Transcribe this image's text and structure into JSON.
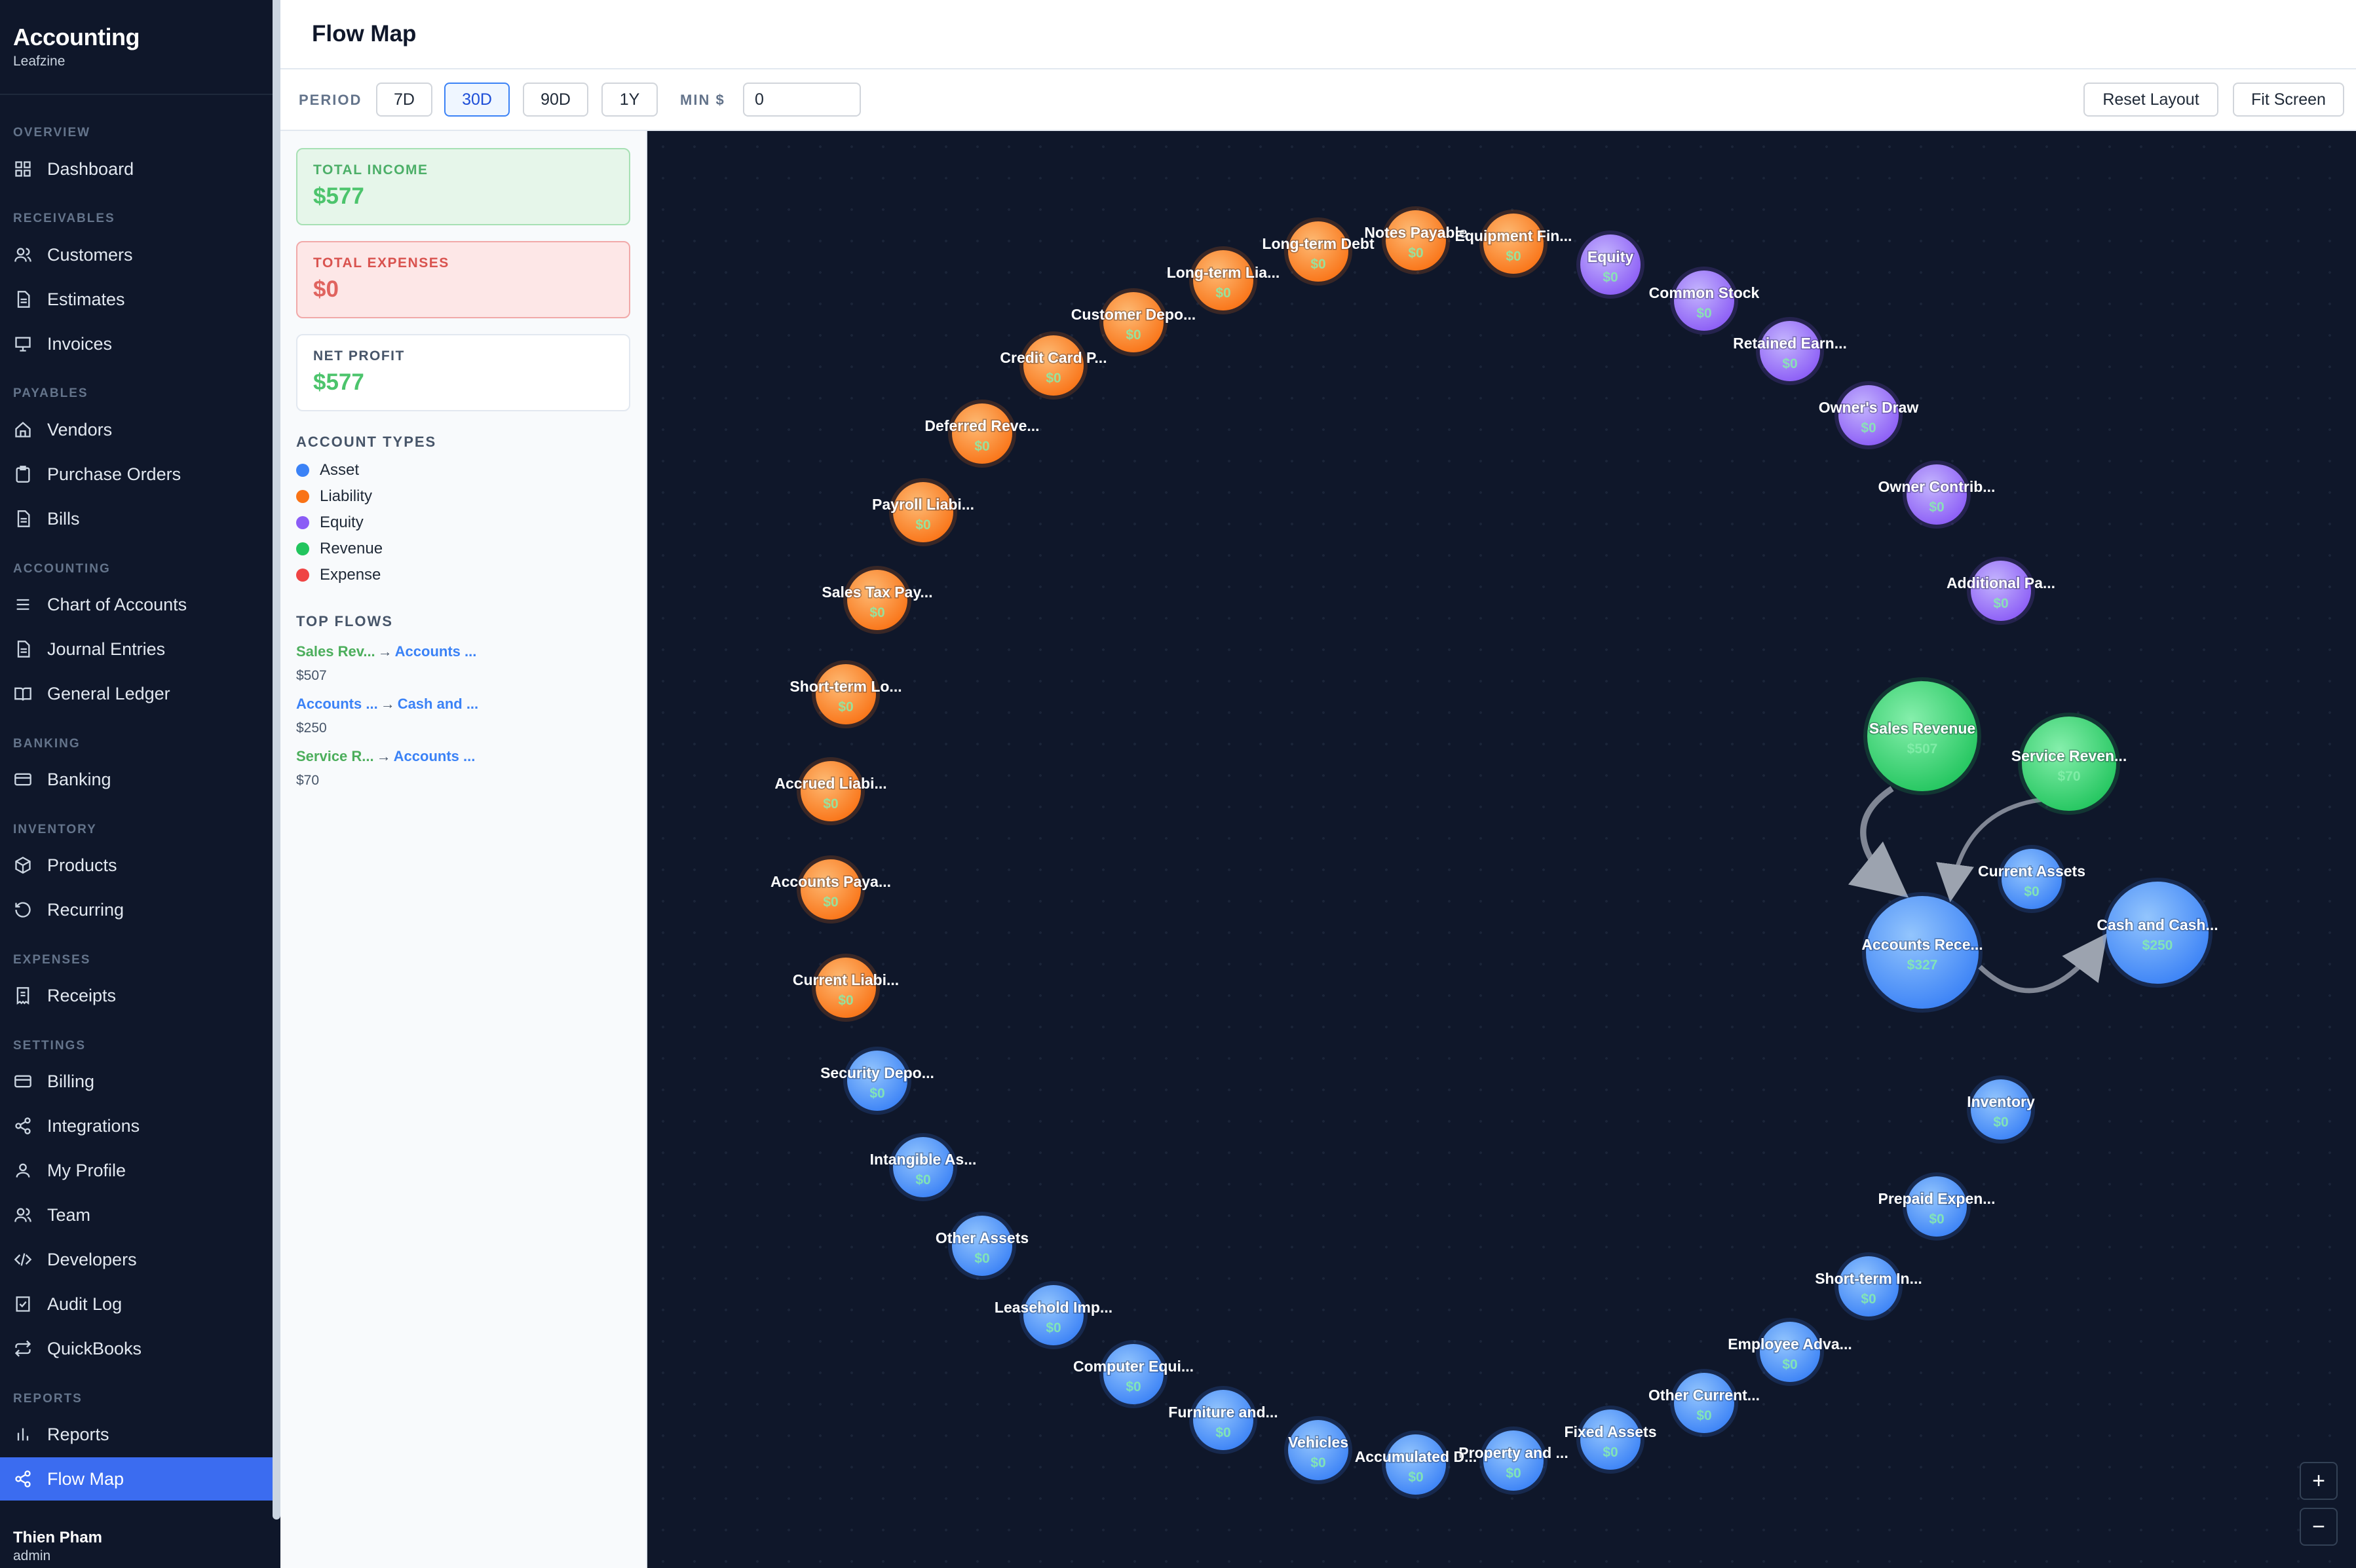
{
  "sidebar": {
    "app_name": "Accounting",
    "org": "Leafzine",
    "sections": {
      "overview": "OVERVIEW",
      "receivables": "RECEIVABLES",
      "payables": "PAYABLES",
      "accounting": "ACCOUNTING",
      "banking": "BANKING",
      "inventory": "INVENTORY",
      "expenses": "EXPENSES",
      "settings": "SETTINGS",
      "reports": "REPORTS"
    },
    "items": {
      "dashboard": "Dashboard",
      "customers": "Customers",
      "estimates": "Estimates",
      "invoices": "Invoices",
      "vendors": "Vendors",
      "purchase_orders": "Purchase Orders",
      "bills": "Bills",
      "chart_of_accounts": "Chart of Accounts",
      "journal_entries": "Journal Entries",
      "general_ledger": "General Ledger",
      "banking": "Banking",
      "products": "Products",
      "recurring": "Recurring",
      "receipts": "Receipts",
      "billing": "Billing",
      "integrations": "Integrations",
      "my_profile": "My Profile",
      "team": "Team",
      "developers": "Developers",
      "audit_log": "Audit Log",
      "quickbooks": "QuickBooks",
      "reports": "Reports",
      "flow_map": "Flow Map"
    },
    "user": {
      "name": "Thien Pham",
      "role": "admin"
    }
  },
  "header": {
    "title": "Flow Map"
  },
  "toolbar": {
    "period_label": "PERIOD",
    "periods": [
      "7D",
      "30D",
      "90D",
      "1Y"
    ],
    "active_period": "30D",
    "min_label": "MIN $",
    "min_value": "0",
    "reset_label": "Reset Layout",
    "fit_label": "Fit Screen"
  },
  "summary": {
    "income_label": "TOTAL INCOME",
    "income_value": "$577",
    "expenses_label": "TOTAL EXPENSES",
    "expenses_value": "$0",
    "profit_label": "NET PROFIT",
    "profit_value": "$577"
  },
  "account_types": {
    "title": "ACCOUNT TYPES",
    "items": [
      {
        "label": "Asset",
        "color": "#3b82f6"
      },
      {
        "label": "Liability",
        "color": "#f97316"
      },
      {
        "label": "Equity",
        "color": "#8b5cf6"
      },
      {
        "label": "Revenue",
        "color": "#22c55e"
      },
      {
        "label": "Expense",
        "color": "#ef4444"
      }
    ]
  },
  "top_flows": {
    "title": "TOP FLOWS",
    "items": [
      {
        "from": "Sales Rev...",
        "to": "Accounts ...",
        "amount": "$507"
      },
      {
        "from": "Accounts ...",
        "to": "Cash and ...",
        "amount": "$250"
      },
      {
        "from": "Service R...",
        "to": "Accounts ...",
        "amount": "$70"
      }
    ]
  },
  "graph": {
    "colors": {
      "asset": "#3b82f6",
      "liability": "#f97316",
      "equity": "#8b5cf6",
      "revenue": "#22c55e"
    },
    "nodes": [
      {
        "id": "notes-payable",
        "label": "Notes Payable",
        "value": "$0",
        "type": "liability"
      },
      {
        "id": "equipment-fin",
        "label": "Equipment Fin...",
        "value": "$0",
        "type": "liability"
      },
      {
        "id": "equity",
        "label": "Equity",
        "value": "$0",
        "type": "equity"
      },
      {
        "id": "common-stock",
        "label": "Common Stock",
        "value": "$0",
        "type": "equity"
      },
      {
        "id": "retained-earn",
        "label": "Retained Earn...",
        "value": "$0",
        "type": "equity"
      },
      {
        "id": "owners-draw",
        "label": "Owner's Draw",
        "value": "$0",
        "type": "equity"
      },
      {
        "id": "owner-contrib",
        "label": "Owner Contrib...",
        "value": "$0",
        "type": "equity"
      },
      {
        "id": "additional-pa",
        "label": "Additional Pa...",
        "value": "$0",
        "type": "equity"
      },
      {
        "id": "sales-revenue",
        "label": "Sales Revenue",
        "value": "$507",
        "type": "revenue"
      },
      {
        "id": "service-reven",
        "label": "Service Reven...",
        "value": "$70",
        "type": "revenue"
      },
      {
        "id": "current-assets",
        "label": "Current Assets",
        "value": "$0",
        "type": "asset"
      },
      {
        "id": "accounts-rece",
        "label": "Accounts Rece...",
        "value": "$327",
        "type": "asset"
      },
      {
        "id": "cash-and-cash",
        "label": "Cash and Cash...",
        "value": "$250",
        "type": "asset"
      },
      {
        "id": "inventory",
        "label": "Inventory",
        "value": "$0",
        "type": "asset"
      },
      {
        "id": "prepaid-expen",
        "label": "Prepaid Expen...",
        "value": "$0",
        "type": "asset"
      },
      {
        "id": "short-term-in",
        "label": "Short-term In...",
        "value": "$0",
        "type": "asset"
      },
      {
        "id": "employee-adva",
        "label": "Employee Adva...",
        "value": "$0",
        "type": "asset"
      },
      {
        "id": "other-current",
        "label": "Other Current...",
        "value": "$0",
        "type": "asset"
      },
      {
        "id": "fixed-assets",
        "label": "Fixed Assets",
        "value": "$0",
        "type": "asset"
      },
      {
        "id": "property-and",
        "label": "Property and ...",
        "value": "$0",
        "type": "asset"
      },
      {
        "id": "accumulated-d",
        "label": "Accumulated D...",
        "value": "$0",
        "type": "asset"
      },
      {
        "id": "vehicles",
        "label": "Vehicles",
        "value": "$0",
        "type": "asset"
      },
      {
        "id": "furniture-and",
        "label": "Furniture and...",
        "value": "$0",
        "type": "asset"
      },
      {
        "id": "computer-equi",
        "label": "Computer Equi...",
        "value": "$0",
        "type": "asset"
      },
      {
        "id": "leasehold-imp",
        "label": "Leasehold Imp...",
        "value": "$0",
        "type": "asset"
      },
      {
        "id": "other-assets",
        "label": "Other Assets",
        "value": "$0",
        "type": "asset"
      },
      {
        "id": "intangible-as",
        "label": "Intangible As...",
        "value": "$0",
        "type": "asset"
      },
      {
        "id": "security-depo",
        "label": "Security Depo...",
        "value": "$0",
        "type": "asset"
      },
      {
        "id": "current-liabi",
        "label": "Current Liabi...",
        "value": "$0",
        "type": "liability"
      },
      {
        "id": "accounts-paya",
        "label": "Accounts Paya...",
        "value": "$0",
        "type": "liability"
      },
      {
        "id": "accrued-liabi",
        "label": "Accrued Liabi...",
        "value": "$0",
        "type": "liability"
      },
      {
        "id": "short-term-lo",
        "label": "Short-term Lo...",
        "value": "$0",
        "type": "liability"
      },
      {
        "id": "sales-tax-pay",
        "label": "Sales Tax Pay...",
        "value": "$0",
        "type": "liability"
      },
      {
        "id": "payroll-liabi",
        "label": "Payroll Liabi...",
        "value": "$0",
        "type": "liability"
      },
      {
        "id": "deferred-reve",
        "label": "Deferred Reve...",
        "value": "$0",
        "type": "liability"
      },
      {
        "id": "credit-card-p",
        "label": "Credit Card P...",
        "value": "$0",
        "type": "liability"
      },
      {
        "id": "customer-depo",
        "label": "Customer Depo...",
        "value": "$0",
        "type": "liability"
      },
      {
        "id": "long-term-lia",
        "label": "Long-term Lia...",
        "value": "$0",
        "type": "liability"
      },
      {
        "id": "long-term-debt",
        "label": "Long-term Debt",
        "value": "$0",
        "type": "liability"
      }
    ],
    "edges": [
      {
        "from": "sales-revenue",
        "to": "accounts-rece",
        "amount": 507
      },
      {
        "from": "service-reven",
        "to": "accounts-rece",
        "amount": 70
      },
      {
        "from": "accounts-rece",
        "to": "cash-and-cash",
        "amount": 250
      }
    ]
  },
  "zoom": {
    "in": "+",
    "out": "−"
  }
}
